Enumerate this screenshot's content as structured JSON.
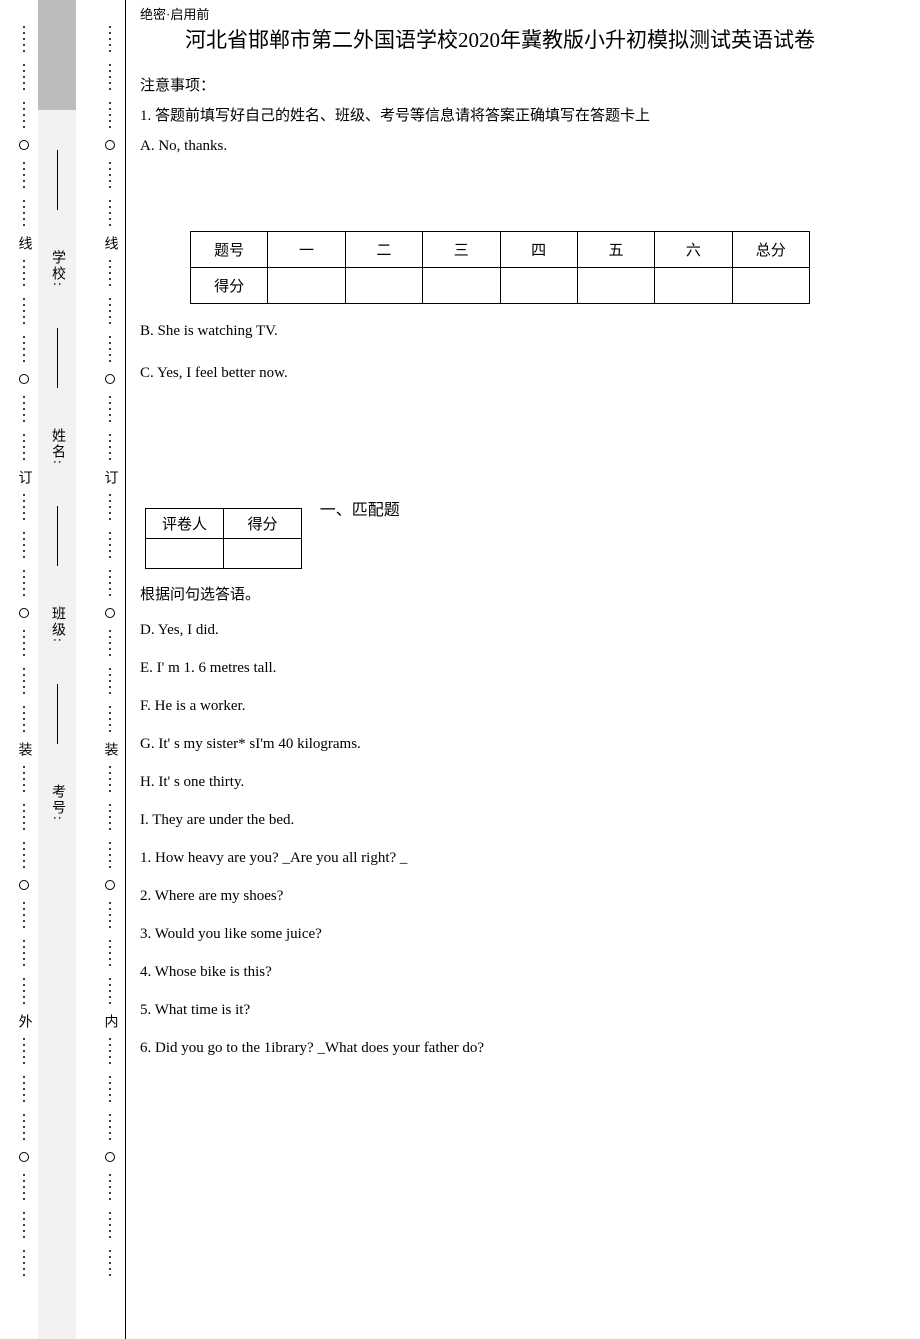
{
  "binding": {
    "outer_chars": [
      "线",
      "订",
      "装",
      "外"
    ],
    "inner_chars": [
      "线",
      "订",
      "装",
      "内"
    ]
  },
  "info_fields": {
    "school": "学校:",
    "name": "姓名:",
    "class": "班级:",
    "exam_no": "考号:"
  },
  "header": {
    "secret": "绝密·启用前",
    "title": "河北省邯郸市第二外国语学校2020年冀教版小升初模拟测试英语试卷"
  },
  "notice": {
    "heading": "注意事项：",
    "line1": "1.  答题前填写好自己的姓名、班级、考号等信息请将答案正确填写在答题卡上",
    "optA": "A.  No, thanks."
  },
  "score_table": {
    "row_label": "题号",
    "cols": [
      "一",
      "二",
      "三",
      "四",
      "五",
      "六",
      "总分"
    ],
    "score_label": "得分"
  },
  "after_table": {
    "optB": "B.  She is watching TV.",
    "optC": "C.  Yes, I feel better now."
  },
  "grader": {
    "col1": "评卷人",
    "col2": "得分",
    "section": "一、匹配题"
  },
  "instruction": "根据问句选答语。",
  "answers": {
    "d": "D.  Yes, I did.",
    "e": "E.  I' m 1. 6 metres tall.",
    "f": "F.  He is a worker.",
    "g": "G.  It' s my sister* sI'm 40 kilograms.",
    "h": "H.  It' s one thirty.",
    "i": "I.   They are under the bed."
  },
  "questions": {
    "q1": "1.  How heavy are you? _Are you all right? _",
    "q2": "2.  Where are my shoes?",
    "q3": "3.  Would you like some juice?",
    "q4": "4.  Whose bike is this?",
    "q5": "5.  What time is it?",
    "q6": "6.  Did you go to the 1ibrary? _What does your father do?"
  }
}
